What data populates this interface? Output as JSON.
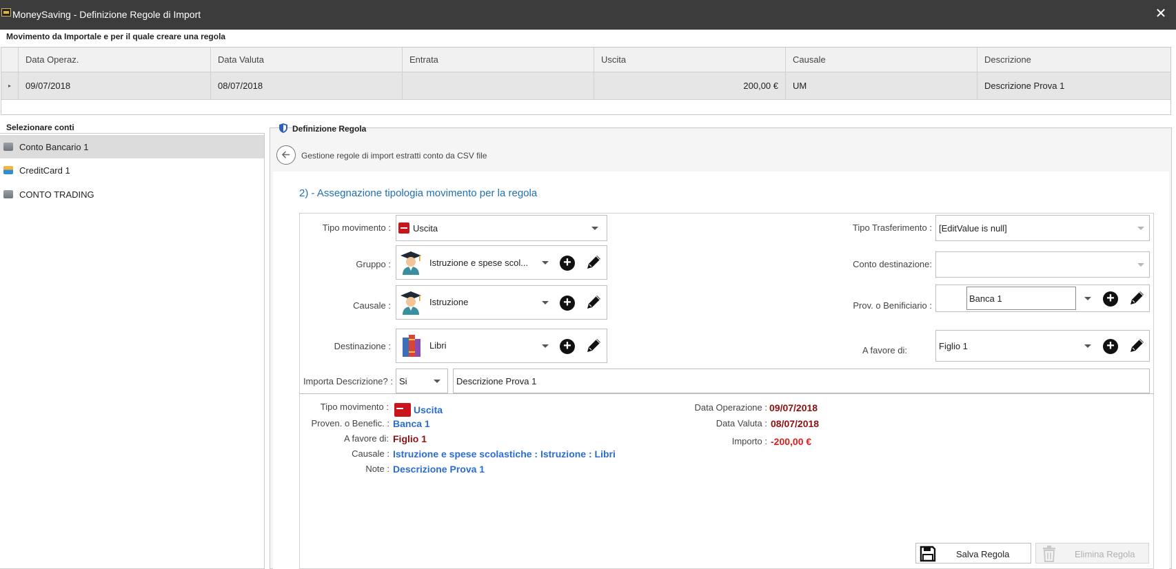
{
  "window": {
    "title": "MoneySaving - Definizione Regole di Import",
    "close_glyph": "✕"
  },
  "top_group": {
    "caption": "Movimento da Importale e per il quale creare una regola",
    "columns": [
      "Data Operaz.",
      "Data Valuta",
      "Entrata",
      "Uscita",
      "Causale",
      "Descrizione"
    ],
    "row": {
      "indicator": "▸",
      "data_operaz": "09/07/2018",
      "data_valuta": "08/07/2018",
      "entrata": "",
      "uscita": "200,00 €",
      "causale": "UM",
      "descrizione": "Descrizione Prova 1"
    }
  },
  "accounts": {
    "caption": "Selezionare conti",
    "items": [
      {
        "label": "Conto Bancario 1",
        "icon": "bank-icon"
      },
      {
        "label": "CreditCard 1",
        "icon": "credit-card-icon"
      },
      {
        "label": "CONTO TRADING",
        "icon": "bank-icon"
      }
    ]
  },
  "rule": {
    "caption": "Definizione Regola",
    "breadcrumb": "Gestione regole di import estratti conto da CSV file",
    "section_title": "2) - Assegnazione tipologia movimento per la regola",
    "form": {
      "tipo_movimento": {
        "label": "Tipo movimento :",
        "value": "Uscita"
      },
      "gruppo": {
        "label": "Gruppo :",
        "value": "Istruzione e spese scol..."
      },
      "causale": {
        "label": "Causale :",
        "value": "Istruzione"
      },
      "destinazione": {
        "label": "Destinazione :",
        "value": "Libri"
      },
      "importa_descrizione": {
        "label": "Importa Descrizione? :",
        "value": "Si",
        "text": "Descrizione Prova 1"
      },
      "tipo_trasferimento": {
        "label": "Tipo Trasferimento :",
        "value": "[EditValue is null]"
      },
      "conto_destinazione": {
        "label": "Conto destinazione:",
        "value": ""
      },
      "prov_beneficiario": {
        "label": "Prov. o Benificiario :",
        "value": "Banca 1"
      },
      "a_favore_di": {
        "label": "A favore di:",
        "value": "Figlio 1"
      }
    },
    "summary": {
      "tipo_movimento_label": "Tipo movimento :",
      "tipo_movimento_value": "Uscita",
      "proven_label": "Proven. o Benefic. :",
      "proven_value": "Banca 1",
      "favore_label": "A favore di:",
      "favore_value": "Figlio 1",
      "causale_label": "Causale :",
      "causale_value": "Istruzione e spese scolastiche : Istruzione : Libri",
      "note_label": "Note :",
      "note_value": "Descrizione Prova 1",
      "data_operazione_label": "Data Operazione :",
      "data_operazione_value": "09/07/2018",
      "data_valuta_label": "Data Valuta :",
      "data_valuta_value": "08/07/2018",
      "importo_label": "Importo :",
      "importo_value": "-200,00 €"
    },
    "buttons": {
      "salva": "Salva Regola",
      "elimina": "Elimina Regola"
    },
    "plus_glyph": "+"
  },
  "colors": {
    "titlebar": "#3c3c3c",
    "section_blue": "#1f6fb5",
    "value_blue": "#2b6cd1",
    "value_dark_red": "#8b1010",
    "value_red": "#e01b1b",
    "minus_red": "#c8141a"
  }
}
